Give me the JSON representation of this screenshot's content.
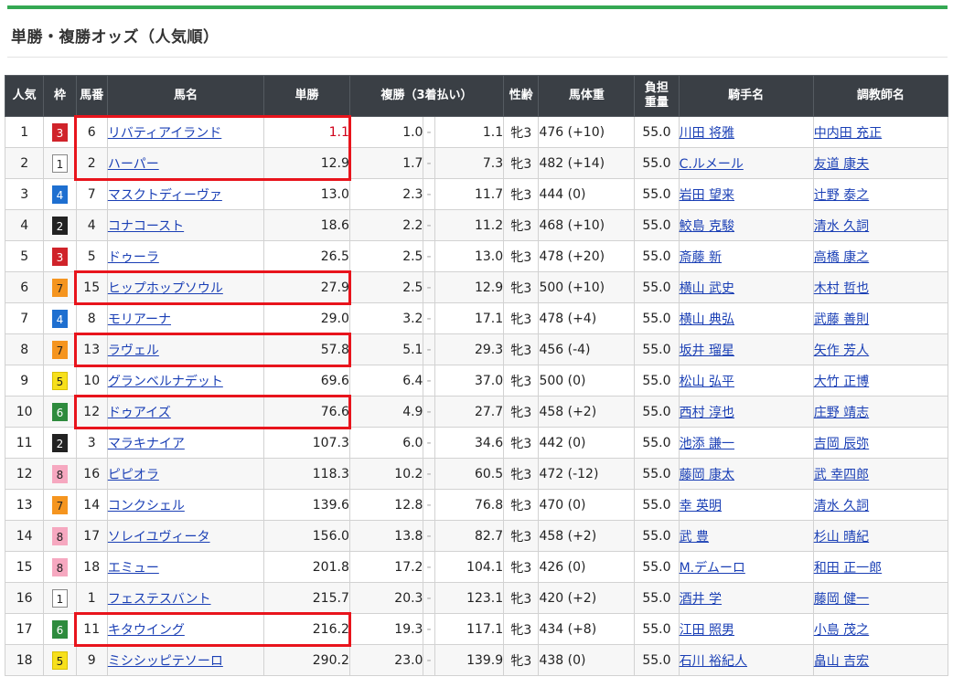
{
  "page": {
    "title": "単勝・複勝オッズ（人気順）"
  },
  "colors": {
    "header_bg": "#3a3f45",
    "link": "#1a3fb5",
    "highlight": "#e8141c",
    "top_rule": "#34a853"
  },
  "table": {
    "headers": {
      "popularity": "人気",
      "waku": "枠",
      "horse_no": "馬番",
      "horse_name": "馬名",
      "win": "単勝",
      "place": "複勝（3着払い）",
      "sex_age": "性齢",
      "weight": "馬体重",
      "burden_1": "負担",
      "burden_2": "重量",
      "jockey": "騎手名",
      "trainer": "調教師名"
    },
    "rows": [
      {
        "pop": "1",
        "waku": "3",
        "no": "6",
        "name": "リバティアイランド",
        "win": "1.1",
        "p_lo": "1.0",
        "p_hi": "1.1",
        "sex": "牝3",
        "wt": "476 (+10)",
        "burden": "55.0",
        "jockey": "川田 将雅",
        "trainer": "中内田 充正"
      },
      {
        "pop": "2",
        "waku": "1",
        "no": "2",
        "name": "ハーパー",
        "win": "12.9",
        "p_lo": "1.7",
        "p_hi": "7.3",
        "sex": "牝3",
        "wt": "482 (+14)",
        "burden": "55.0",
        "jockey": "C.ルメール",
        "trainer": "友道 康夫"
      },
      {
        "pop": "3",
        "waku": "4",
        "no": "7",
        "name": "マスクトディーヴァ",
        "win": "13.0",
        "p_lo": "2.3",
        "p_hi": "11.7",
        "sex": "牝3",
        "wt": "444 (0)",
        "burden": "55.0",
        "jockey": "岩田 望来",
        "trainer": "辻野 泰之"
      },
      {
        "pop": "4",
        "waku": "2",
        "no": "4",
        "name": "コナコースト",
        "win": "18.6",
        "p_lo": "2.2",
        "p_hi": "11.2",
        "sex": "牝3",
        "wt": "468 (+10)",
        "burden": "55.0",
        "jockey": "鮫島 克駿",
        "trainer": "清水 久詞"
      },
      {
        "pop": "5",
        "waku": "3",
        "no": "5",
        "name": "ドゥーラ",
        "win": "26.5",
        "p_lo": "2.5",
        "p_hi": "13.0",
        "sex": "牝3",
        "wt": "478 (+20)",
        "burden": "55.0",
        "jockey": "斎藤 新",
        "trainer": "高橋 康之"
      },
      {
        "pop": "6",
        "waku": "7",
        "no": "15",
        "name": "ヒップホップソウル",
        "win": "27.9",
        "p_lo": "2.5",
        "p_hi": "12.9",
        "sex": "牝3",
        "wt": "500 (+10)",
        "burden": "55.0",
        "jockey": "横山 武史",
        "trainer": "木村 哲也"
      },
      {
        "pop": "7",
        "waku": "4",
        "no": "8",
        "name": "モリアーナ",
        "win": "29.0",
        "p_lo": "3.2",
        "p_hi": "17.1",
        "sex": "牝3",
        "wt": "478 (+4)",
        "burden": "55.0",
        "jockey": "横山 典弘",
        "trainer": "武藤 善則"
      },
      {
        "pop": "8",
        "waku": "7",
        "no": "13",
        "name": "ラヴェル",
        "win": "57.8",
        "p_lo": "5.1",
        "p_hi": "29.3",
        "sex": "牝3",
        "wt": "456 (-4)",
        "burden": "55.0",
        "jockey": "坂井 瑠星",
        "trainer": "矢作 芳人"
      },
      {
        "pop": "9",
        "waku": "5",
        "no": "10",
        "name": "グランベルナデット",
        "win": "69.6",
        "p_lo": "6.4",
        "p_hi": "37.0",
        "sex": "牝3",
        "wt": "500 (0)",
        "burden": "55.0",
        "jockey": "松山 弘平",
        "trainer": "大竹 正博"
      },
      {
        "pop": "10",
        "waku": "6",
        "no": "12",
        "name": "ドゥアイズ",
        "win": "76.6",
        "p_lo": "4.9",
        "p_hi": "27.7",
        "sex": "牝3",
        "wt": "458 (+2)",
        "burden": "55.0",
        "jockey": "西村 淳也",
        "trainer": "庄野 靖志"
      },
      {
        "pop": "11",
        "waku": "2",
        "no": "3",
        "name": "マラキナイア",
        "win": "107.3",
        "p_lo": "6.0",
        "p_hi": "34.6",
        "sex": "牝3",
        "wt": "442 (0)",
        "burden": "55.0",
        "jockey": "池添 謙一",
        "trainer": "吉岡 辰弥"
      },
      {
        "pop": "12",
        "waku": "8",
        "no": "16",
        "name": "ピピオラ",
        "win": "118.3",
        "p_lo": "10.2",
        "p_hi": "60.5",
        "sex": "牝3",
        "wt": "472 (-12)",
        "burden": "55.0",
        "jockey": "藤岡 康太",
        "trainer": "武 幸四郎"
      },
      {
        "pop": "13",
        "waku": "7",
        "no": "14",
        "name": "コンクシェル",
        "win": "139.6",
        "p_lo": "12.8",
        "p_hi": "76.8",
        "sex": "牝3",
        "wt": "470 (0)",
        "burden": "55.0",
        "jockey": "幸 英明",
        "trainer": "清水 久詞"
      },
      {
        "pop": "14",
        "waku": "8",
        "no": "17",
        "name": "ソレイユヴィータ",
        "win": "156.0",
        "p_lo": "13.8",
        "p_hi": "82.7",
        "sex": "牝3",
        "wt": "458 (+2)",
        "burden": "55.0",
        "jockey": "武 豊",
        "trainer": "杉山 晴紀"
      },
      {
        "pop": "15",
        "waku": "8",
        "no": "18",
        "name": "エミュー",
        "win": "201.8",
        "p_lo": "17.2",
        "p_hi": "104.1",
        "sex": "牝3",
        "wt": "426 (0)",
        "burden": "55.0",
        "jockey": "M.デムーロ",
        "trainer": "和田 正一郎"
      },
      {
        "pop": "16",
        "waku": "1",
        "no": "1",
        "name": "フェステスバント",
        "win": "215.7",
        "p_lo": "20.3",
        "p_hi": "123.1",
        "sex": "牝3",
        "wt": "420 (+2)",
        "burden": "55.0",
        "jockey": "酒井 学",
        "trainer": "藤岡 健一"
      },
      {
        "pop": "17",
        "waku": "6",
        "no": "11",
        "name": "キタウイング",
        "win": "216.2",
        "p_lo": "19.3",
        "p_hi": "117.1",
        "sex": "牝3",
        "wt": "434 (+8)",
        "burden": "55.0",
        "jockey": "江田 照男",
        "trainer": "小島 茂之"
      },
      {
        "pop": "18",
        "waku": "5",
        "no": "9",
        "name": "ミシシッピテソーロ",
        "win": "290.2",
        "p_lo": "23.0",
        "p_hi": "139.9",
        "sex": "牝3",
        "wt": "438 (0)",
        "burden": "55.0",
        "jockey": "石川 裕紀人",
        "trainer": "畠山 吉宏"
      }
    ]
  }
}
